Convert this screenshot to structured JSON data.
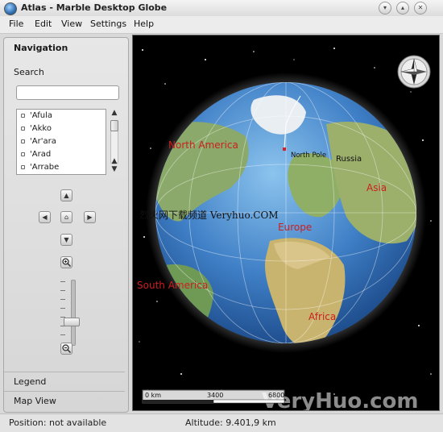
{
  "window": {
    "title": "Atlas - Marble Desktop Globe"
  },
  "menu": [
    "File",
    "Edit",
    "View",
    "Settings",
    "Help"
  ],
  "navigation": {
    "header": "Navigation",
    "search_label": "Search",
    "search_value": "",
    "places": [
      "'Afula",
      "'Akko",
      "'Ar'ara",
      "'Arad",
      "'Arrabe"
    ]
  },
  "panels": {
    "legend": "Legend",
    "map_view": "Map View"
  },
  "map": {
    "labels": {
      "north_america": "North America",
      "north_pole": "North Pole",
      "russia": "Russia",
      "asia": "Asia",
      "europe": "Europe",
      "south_america": "South America",
      "africa": "Africa"
    },
    "scale": {
      "start": "0 km",
      "mid": "3400",
      "end": "6800"
    },
    "watermark": "烈火网下载频道 Veryhuo.COM",
    "watermark_big": "VeryHuo.com"
  },
  "status": {
    "position": "Position: not available",
    "altitude": "Altitude:  9.401,9 km"
  },
  "colors": {
    "ocean": "#3f7fc6",
    "land": "#8ba96a",
    "label_red": "#cc1f1f",
    "space": "#000000"
  }
}
